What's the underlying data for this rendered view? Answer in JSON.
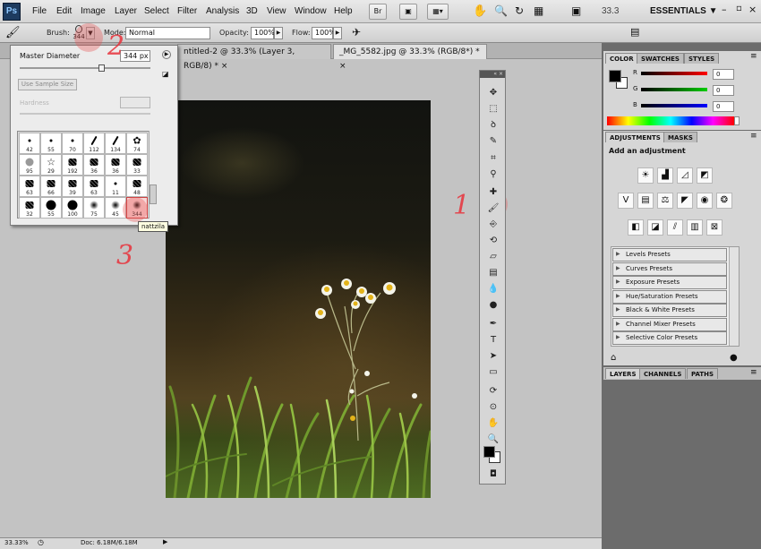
{
  "app": {
    "logo": "Ps"
  },
  "menu": [
    "File",
    "Edit",
    "Image",
    "Layer",
    "Select",
    "Filter",
    "Analysis",
    "3D",
    "View",
    "Window",
    "Help"
  ],
  "menubar_buttons": {
    "bridge": "Br",
    "zoom": "33.3",
    "workspace": "ESSENTIALS ▼"
  },
  "options": {
    "brush_label": "Brush:",
    "brush_size": "344",
    "mode_label": "Mode:",
    "mode_value": "Normal",
    "opacity_label": "Opacity:",
    "opacity_value": "100%",
    "flow_label": "Flow:",
    "flow_value": "100%"
  },
  "tabs": [
    {
      "label": "ntitled-2 @ 33.3% (Layer 3, RGB/8) *  ×",
      "active": false
    },
    {
      "label": "_MG_5582.jpg @ 33.3% (RGB/8*) *  ×",
      "active": true
    }
  ],
  "brush_popup": {
    "master_diameter_label": "Master Diameter",
    "master_diameter_value": "344 px",
    "use_sample_size": "Use Sample Size",
    "hardness_label": "Hardness",
    "slider_fraction": 0.62,
    "tooltip": "nattzila",
    "presets": [
      {
        "size": "42"
      },
      {
        "size": "55"
      },
      {
        "size": "70"
      },
      {
        "size": "112"
      },
      {
        "size": "134"
      },
      {
        "size": "74"
      },
      {
        "size": "95"
      },
      {
        "size": "29"
      },
      {
        "size": "192"
      },
      {
        "size": "36"
      },
      {
        "size": "36"
      },
      {
        "size": "33"
      },
      {
        "size": "63"
      },
      {
        "size": "66"
      },
      {
        "size": "39"
      },
      {
        "size": "63"
      },
      {
        "size": "11"
      },
      {
        "size": "48"
      },
      {
        "size": "32"
      },
      {
        "size": "55"
      },
      {
        "size": "100"
      },
      {
        "size": "75"
      },
      {
        "size": "45"
      },
      {
        "size": "344"
      }
    ]
  },
  "annotations": [
    "1",
    "2",
    "3"
  ],
  "panels": {
    "color_tabs": [
      "COLOR",
      "SWATCHES",
      "STYLES"
    ],
    "rgb_labels": [
      "R",
      "G",
      "B"
    ],
    "rgb_values": [
      "0",
      "0",
      "0"
    ],
    "adjust_tabs": [
      "ADJUSTMENTS",
      "MASKS"
    ],
    "adjust_heading": "Add an adjustment",
    "presets": [
      "Levels Presets",
      "Curves Presets",
      "Exposure Presets",
      "Hue/Saturation Presets",
      "Black & White Presets",
      "Channel Mixer Presets",
      "Selective Color Presets"
    ],
    "layers_tabs": [
      "LAYERS",
      "CHANNELS",
      "PATHS"
    ]
  },
  "status": {
    "zoom": "33.33%",
    "doc": "Doc: 6.18M/6.18M"
  },
  "colors": {
    "annotation": "#e8323b",
    "foreground": "#000000",
    "background": "#ffffff"
  },
  "icons": [
    "brush-icon",
    "hand-icon",
    "zoom-icon",
    "rotate-icon",
    "move-icon",
    "marquee-icon",
    "lasso-icon",
    "quick-select-icon",
    "crop-icon",
    "eyedropper-icon",
    "healing-icon",
    "brush-tool-icon",
    "clone-icon",
    "history-brush-icon",
    "eraser-icon",
    "gradient-icon",
    "blur-icon",
    "dodge-icon",
    "pen-icon",
    "type-icon",
    "path-select-icon",
    "shape-icon",
    "3d-rotate-icon",
    "3d-orbit-icon",
    "hand-tool-icon",
    "zoom-tool-icon"
  ]
}
